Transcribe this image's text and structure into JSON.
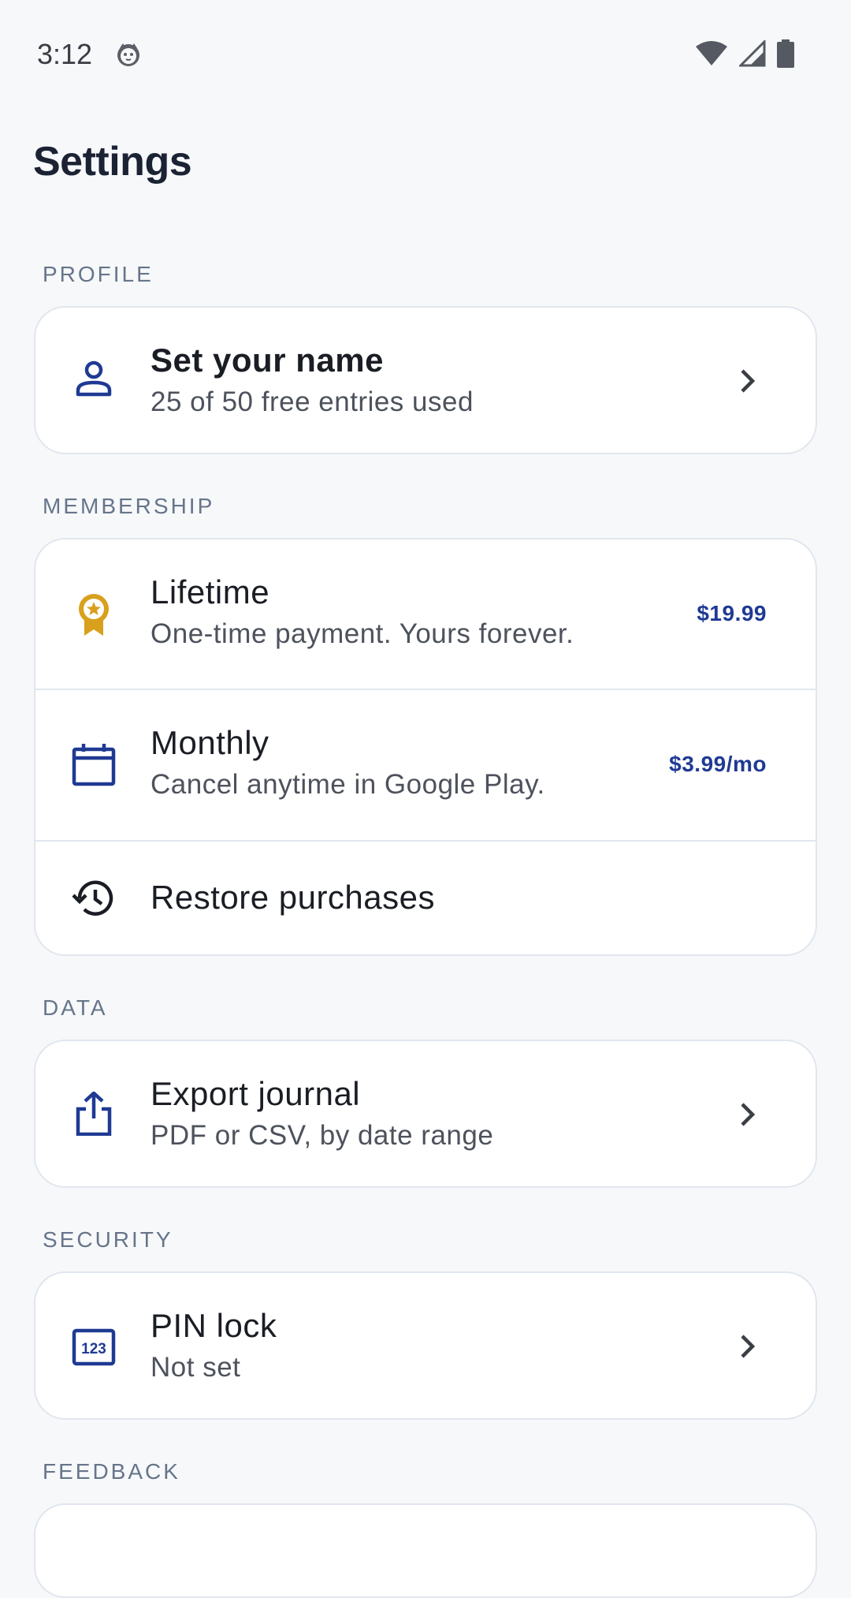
{
  "status_bar": {
    "time": "3:12",
    "app_icon": "cat-face-icon",
    "wifi_icon": "wifi-icon",
    "signal_icon": "signal-icon",
    "battery_icon": "battery-icon"
  },
  "page": {
    "title": "Settings"
  },
  "colors": {
    "accent": "#1f3a93",
    "gold": "#d8a01c",
    "section_label": "#66758a",
    "background": "#f7f8fa",
    "card_border": "#e1e6ee"
  },
  "sections": {
    "profile": {
      "label": "PROFILE",
      "items": [
        {
          "icon": "person-icon",
          "title": "Set your name",
          "subtitle": "25 of 50 free entries used",
          "trailing_icon": "chevron-right-icon"
        }
      ]
    },
    "membership": {
      "label": "MEMBERSHIP",
      "items": [
        {
          "icon": "award-medal-icon",
          "title": "Lifetime",
          "subtitle": "One-time payment. Yours forever.",
          "price": "$19.99"
        },
        {
          "icon": "calendar-icon",
          "title": "Monthly",
          "subtitle": "Cancel anytime in Google Play.",
          "price": "$3.99/mo"
        },
        {
          "icon": "history-icon",
          "title": "Restore purchases"
        }
      ]
    },
    "data": {
      "label": "DATA",
      "items": [
        {
          "icon": "share-export-icon",
          "title": "Export journal",
          "subtitle": "PDF or CSV, by date range",
          "trailing_icon": "chevron-right-icon"
        }
      ]
    },
    "security": {
      "label": "SECURITY",
      "items": [
        {
          "icon": "pin-123-icon",
          "title": "PIN lock",
          "subtitle": "Not set",
          "trailing_icon": "chevron-right-icon"
        }
      ]
    },
    "feedback": {
      "label": "FEEDBACK"
    }
  }
}
